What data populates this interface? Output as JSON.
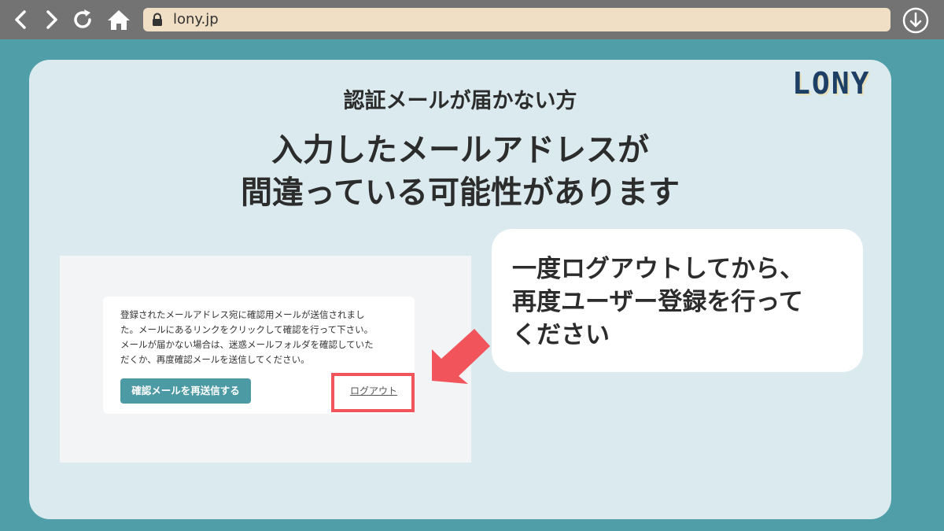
{
  "browser": {
    "url": "lony.jp",
    "icons": [
      "back-icon",
      "forward-icon",
      "reload-icon",
      "home-icon",
      "lock-icon",
      "download-icon"
    ]
  },
  "card": {
    "logo": "LONY",
    "subtitle": "認証メールが届かない方",
    "headline_line1": "入力したメールアドレスが",
    "headline_line2": "間違っている可能性があります"
  },
  "screenshot": {
    "message_line1": "登録されたメールアドレス宛に確認用メールが送信されまし",
    "message_line2": "た。メールにあるリンクをクリックして確認を行って下さい。",
    "message_line3": "メールが届かない場合は、迷惑メールフォルダを確認していた",
    "message_line4": "だくか、再度確認メールを送信してください。",
    "resend_button": "確認メールを再送信する",
    "logout_link": "ログアウト"
  },
  "bubble": {
    "line1": "一度ログアウトしてから、",
    "line2": "再度ユーザー登録を行って",
    "line3": "ください"
  },
  "colors": {
    "background": "#4f9ea8",
    "toolbar": "#737373",
    "address_bar": "#f0dfc4",
    "card": "#dbeaee",
    "accent_button": "#4c9aa3",
    "highlight": "#f2545b",
    "logo": "#1d3f66"
  }
}
